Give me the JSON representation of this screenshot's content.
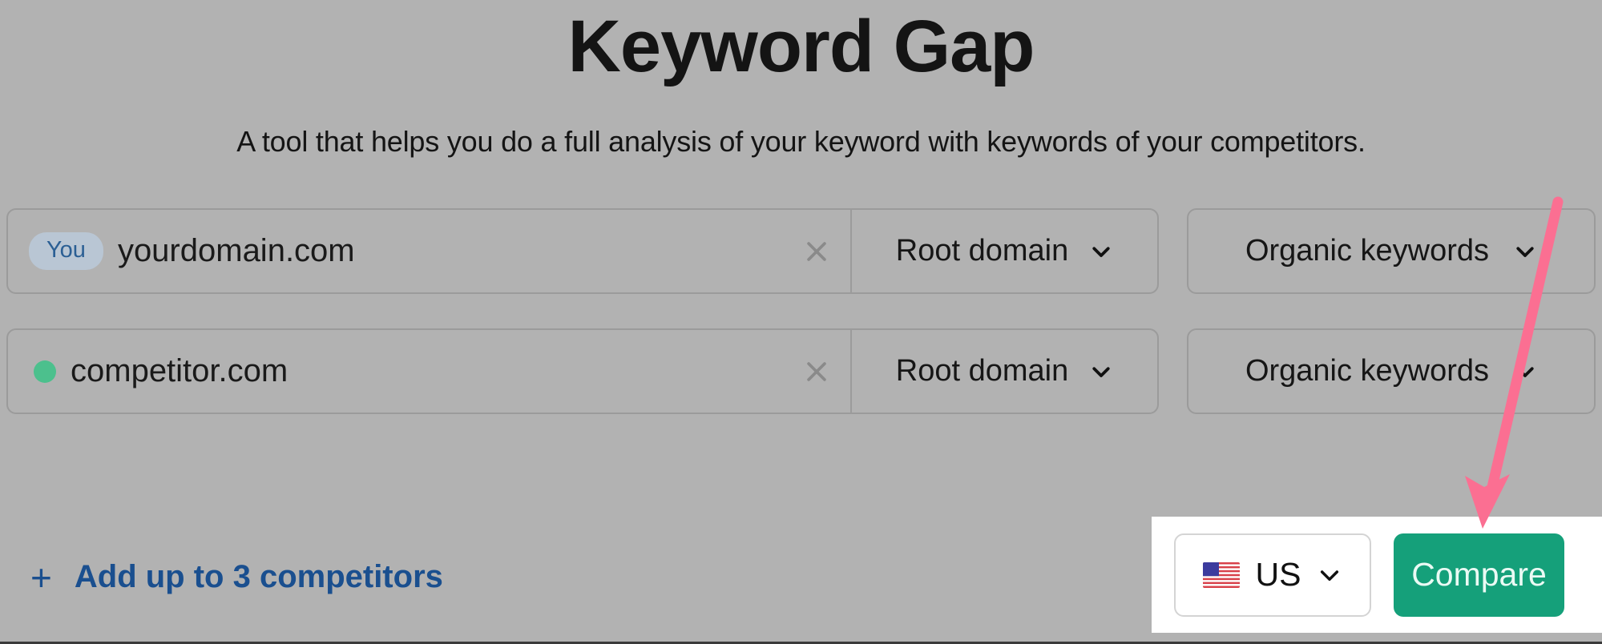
{
  "header": {
    "title": "Keyword Gap",
    "subtitle": "A tool that helps you do a full analysis of your keyword with keywords of your competitors."
  },
  "rows": [
    {
      "badge_label": "You",
      "badge_type": "you-badge",
      "domain": "yourdomain.com",
      "clear_icon": "close-icon",
      "type_value": "Root domain",
      "type_chevron": "chevron-down-icon",
      "metric_value": "Organic keywords",
      "metric_chevron": "chevron-down-icon"
    },
    {
      "badge_label": "",
      "badge_type": "color-dot",
      "dot_color": "#4cc08d",
      "domain": "competitor.com",
      "clear_icon": "close-icon",
      "type_value": "Root domain",
      "type_chevron": "chevron-down-icon",
      "metric_value": "Organic keywords",
      "metric_chevron": "chevron-down-icon"
    }
  ],
  "footer": {
    "add_competitors_label": "Add up to 3 competitors",
    "add_icon": "plus-icon",
    "country_label": "US",
    "country_flag": "us-flag-icon",
    "country_chevron": "chevron-down-icon",
    "compare_label": "Compare"
  },
  "colors": {
    "background": "#b2b2b2",
    "accent_green": "#15a07a",
    "link_blue": "#1a4f8f",
    "badge_bg": "#b9c6d4",
    "badge_text": "#2b5f94",
    "dot_green": "#4cc08d",
    "annotation_pink": "#fb6f92",
    "highlight_white": "#ffffff",
    "border_grey": "#9b9b9b"
  },
  "annotation": {
    "type": "arrow",
    "color": "#fb6f92",
    "points_to": "compare-button"
  }
}
